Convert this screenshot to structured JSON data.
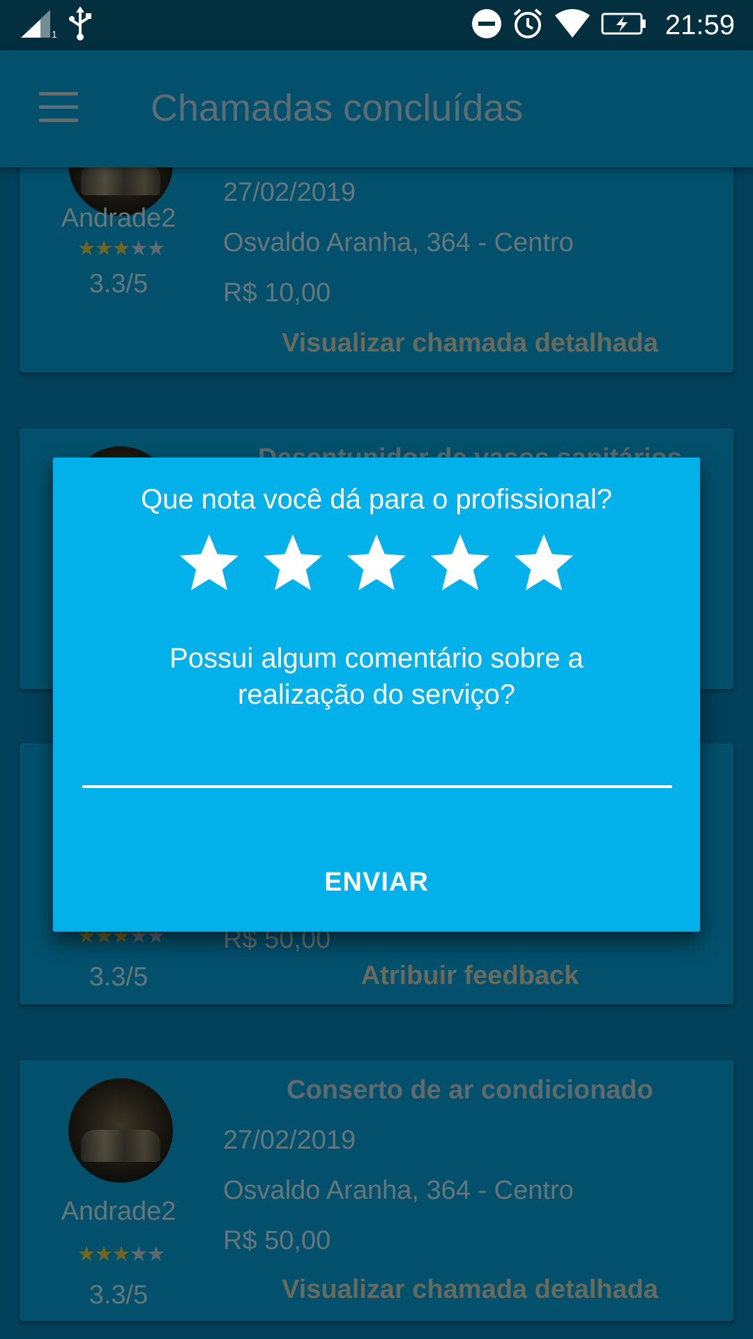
{
  "status_bar": {
    "time": "21:59",
    "sim_label": "1",
    "icons": [
      "signal-icon",
      "usb-icon",
      "do-not-disturb-icon",
      "alarm-icon",
      "wifi-icon",
      "battery-charging-icon"
    ]
  },
  "app_bar": {
    "title": "Chamadas concluídas",
    "menu_icon": "hamburger-menu-icon"
  },
  "calls": [
    {
      "title": "",
      "date": "27/02/2019",
      "address": "Osvaldo Aranha, 364 - Centro",
      "price": "R$ 10,00",
      "user": "Andrade2",
      "rating_value": 3.3,
      "rating_text": "3.3/5",
      "action": "Visualizar chamada detalhada"
    },
    {
      "title": "Desentupidor de vasos sanitários",
      "date": "",
      "address": "",
      "price": "",
      "user": "",
      "rating_text": "",
      "action": ""
    },
    {
      "title": "",
      "date": "",
      "address": "",
      "price": "R$ 50,00",
      "user": "",
      "rating_value": 3.3,
      "rating_text": "3.3/5",
      "action": "Atribuir feedback"
    },
    {
      "title": "Conserto de ar condicionado",
      "date": "27/02/2019",
      "address": "Osvaldo Aranha, 364 - Centro",
      "price": "R$ 50,00",
      "user": "Andrade2",
      "rating_value": 3.3,
      "rating_text": "3.3/5",
      "action": "Visualizar chamada detalhada"
    }
  ],
  "dialog": {
    "question": "Que nota você dá para o profissional?",
    "stars_total": 5,
    "comment_prompt_line1": "Possui algum comentário sobre a",
    "comment_prompt_line2": "realização do serviço?",
    "comment_value": "",
    "comment_placeholder": "",
    "submit_label": "ENVIAR"
  },
  "colors": {
    "dialog_background": "#03b1ea",
    "scrim_background": "#03405a",
    "star_filled_dim": "#6f6622"
  }
}
